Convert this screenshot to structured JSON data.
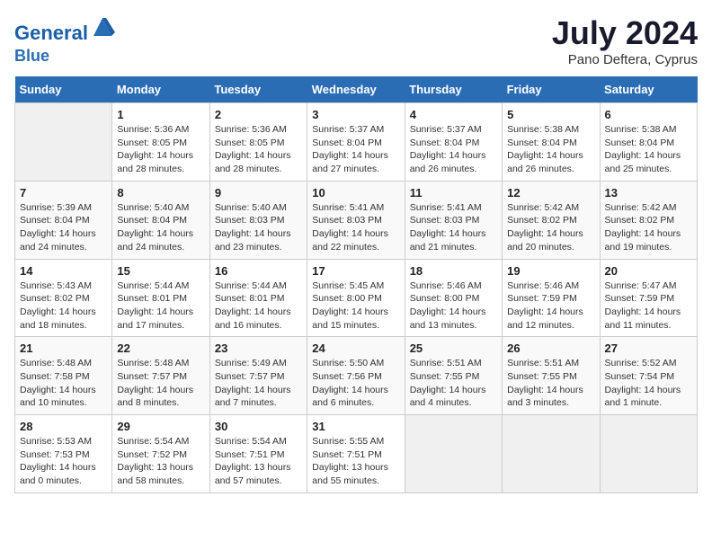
{
  "header": {
    "logo_line1": "General",
    "logo_line2": "Blue",
    "month_year": "July 2024",
    "location": "Pano Deftera, Cyprus"
  },
  "days_of_week": [
    "Sunday",
    "Monday",
    "Tuesday",
    "Wednesday",
    "Thursday",
    "Friday",
    "Saturday"
  ],
  "weeks": [
    [
      {
        "day": "",
        "info": ""
      },
      {
        "day": "1",
        "info": "Sunrise: 5:36 AM\nSunset: 8:05 PM\nDaylight: 14 hours\nand 28 minutes."
      },
      {
        "day": "2",
        "info": "Sunrise: 5:36 AM\nSunset: 8:05 PM\nDaylight: 14 hours\nand 28 minutes."
      },
      {
        "day": "3",
        "info": "Sunrise: 5:37 AM\nSunset: 8:04 PM\nDaylight: 14 hours\nand 27 minutes."
      },
      {
        "day": "4",
        "info": "Sunrise: 5:37 AM\nSunset: 8:04 PM\nDaylight: 14 hours\nand 26 minutes."
      },
      {
        "day": "5",
        "info": "Sunrise: 5:38 AM\nSunset: 8:04 PM\nDaylight: 14 hours\nand 26 minutes."
      },
      {
        "day": "6",
        "info": "Sunrise: 5:38 AM\nSunset: 8:04 PM\nDaylight: 14 hours\nand 25 minutes."
      }
    ],
    [
      {
        "day": "7",
        "info": "Sunrise: 5:39 AM\nSunset: 8:04 PM\nDaylight: 14 hours\nand 24 minutes."
      },
      {
        "day": "8",
        "info": "Sunrise: 5:40 AM\nSunset: 8:04 PM\nDaylight: 14 hours\nand 24 minutes."
      },
      {
        "day": "9",
        "info": "Sunrise: 5:40 AM\nSunset: 8:03 PM\nDaylight: 14 hours\nand 23 minutes."
      },
      {
        "day": "10",
        "info": "Sunrise: 5:41 AM\nSunset: 8:03 PM\nDaylight: 14 hours\nand 22 minutes."
      },
      {
        "day": "11",
        "info": "Sunrise: 5:41 AM\nSunset: 8:03 PM\nDaylight: 14 hours\nand 21 minutes."
      },
      {
        "day": "12",
        "info": "Sunrise: 5:42 AM\nSunset: 8:02 PM\nDaylight: 14 hours\nand 20 minutes."
      },
      {
        "day": "13",
        "info": "Sunrise: 5:42 AM\nSunset: 8:02 PM\nDaylight: 14 hours\nand 19 minutes."
      }
    ],
    [
      {
        "day": "14",
        "info": "Sunrise: 5:43 AM\nSunset: 8:02 PM\nDaylight: 14 hours\nand 18 minutes."
      },
      {
        "day": "15",
        "info": "Sunrise: 5:44 AM\nSunset: 8:01 PM\nDaylight: 14 hours\nand 17 minutes."
      },
      {
        "day": "16",
        "info": "Sunrise: 5:44 AM\nSunset: 8:01 PM\nDaylight: 14 hours\nand 16 minutes."
      },
      {
        "day": "17",
        "info": "Sunrise: 5:45 AM\nSunset: 8:00 PM\nDaylight: 14 hours\nand 15 minutes."
      },
      {
        "day": "18",
        "info": "Sunrise: 5:46 AM\nSunset: 8:00 PM\nDaylight: 14 hours\nand 13 minutes."
      },
      {
        "day": "19",
        "info": "Sunrise: 5:46 AM\nSunset: 7:59 PM\nDaylight: 14 hours\nand 12 minutes."
      },
      {
        "day": "20",
        "info": "Sunrise: 5:47 AM\nSunset: 7:59 PM\nDaylight: 14 hours\nand 11 minutes."
      }
    ],
    [
      {
        "day": "21",
        "info": "Sunrise: 5:48 AM\nSunset: 7:58 PM\nDaylight: 14 hours\nand 10 minutes."
      },
      {
        "day": "22",
        "info": "Sunrise: 5:48 AM\nSunset: 7:57 PM\nDaylight: 14 hours\nand 8 minutes."
      },
      {
        "day": "23",
        "info": "Sunrise: 5:49 AM\nSunset: 7:57 PM\nDaylight: 14 hours\nand 7 minutes."
      },
      {
        "day": "24",
        "info": "Sunrise: 5:50 AM\nSunset: 7:56 PM\nDaylight: 14 hours\nand 6 minutes."
      },
      {
        "day": "25",
        "info": "Sunrise: 5:51 AM\nSunset: 7:55 PM\nDaylight: 14 hours\nand 4 minutes."
      },
      {
        "day": "26",
        "info": "Sunrise: 5:51 AM\nSunset: 7:55 PM\nDaylight: 14 hours\nand 3 minutes."
      },
      {
        "day": "27",
        "info": "Sunrise: 5:52 AM\nSunset: 7:54 PM\nDaylight: 14 hours\nand 1 minute."
      }
    ],
    [
      {
        "day": "28",
        "info": "Sunrise: 5:53 AM\nSunset: 7:53 PM\nDaylight: 14 hours\nand 0 minutes."
      },
      {
        "day": "29",
        "info": "Sunrise: 5:54 AM\nSunset: 7:52 PM\nDaylight: 13 hours\nand 58 minutes."
      },
      {
        "day": "30",
        "info": "Sunrise: 5:54 AM\nSunset: 7:51 PM\nDaylight: 13 hours\nand 57 minutes."
      },
      {
        "day": "31",
        "info": "Sunrise: 5:55 AM\nSunset: 7:51 PM\nDaylight: 13 hours\nand 55 minutes."
      },
      {
        "day": "",
        "info": ""
      },
      {
        "day": "",
        "info": ""
      },
      {
        "day": "",
        "info": ""
      }
    ]
  ]
}
